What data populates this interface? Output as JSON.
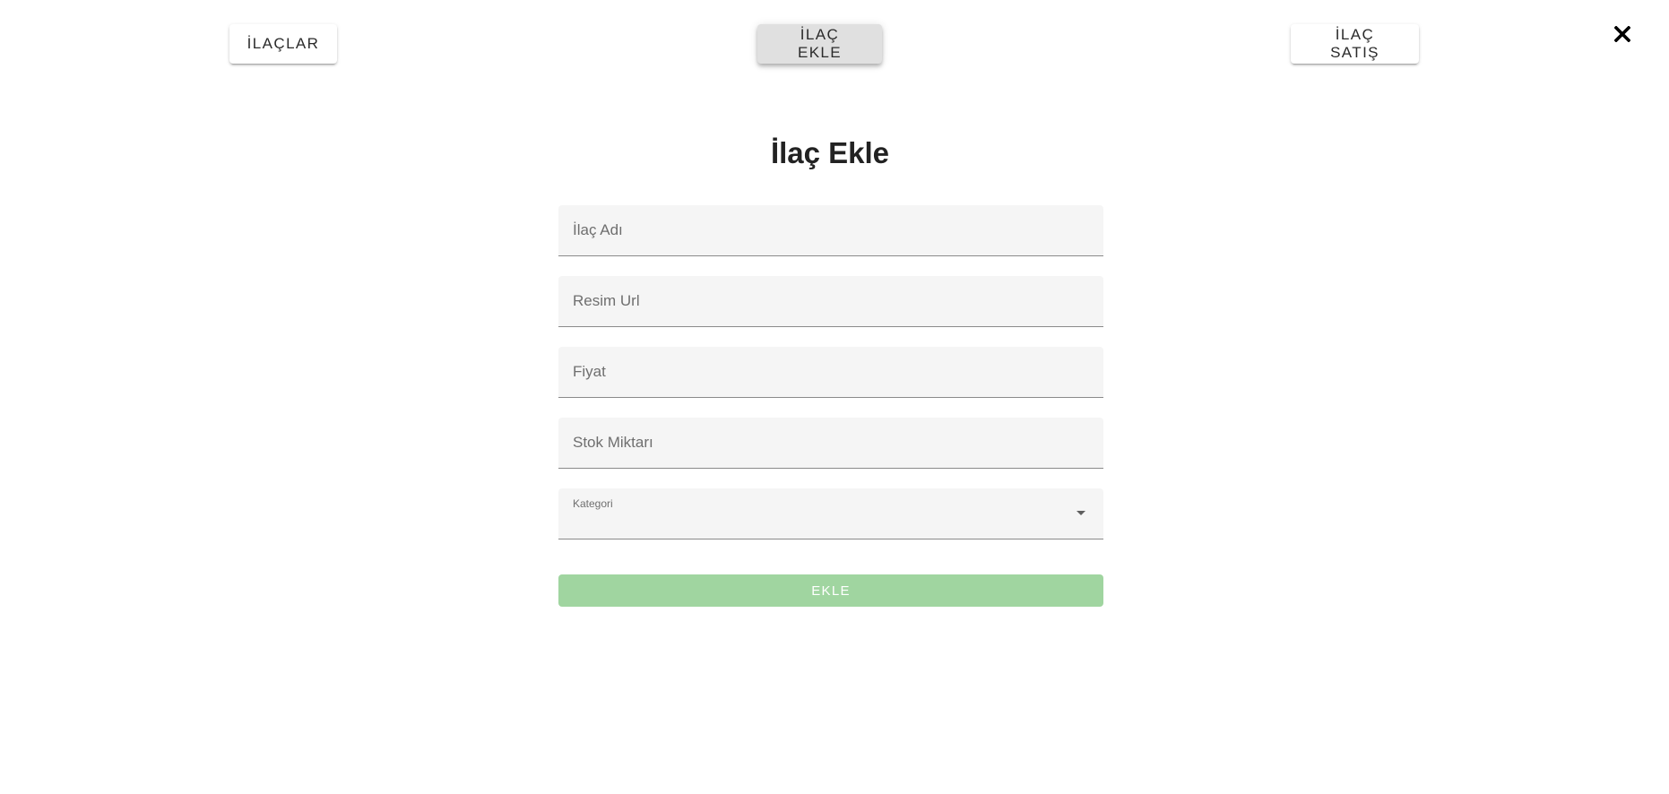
{
  "nav": {
    "ilaclar_label": "İLAÇLAR",
    "ilac_ekle_label": "İLAÇ EKLE",
    "ilac_satis_label": "İLAÇ SATIŞ",
    "active_tab": "ilac_ekle"
  },
  "icons": {
    "close": "close-icon",
    "dropdown": "arrow-drop-down-icon"
  },
  "form": {
    "title": "İlaç Ekle",
    "fields": {
      "ilac_adi": {
        "placeholder": "İlaç Adı",
        "value": ""
      },
      "resim_url": {
        "placeholder": "Resim Url",
        "value": ""
      },
      "fiyat": {
        "placeholder": "Fiyat",
        "value": ""
      },
      "stok_miktari": {
        "placeholder": "Stok Miktarı",
        "value": ""
      },
      "kategori": {
        "label": "Kategori",
        "value": ""
      }
    },
    "submit_label": "EKLE",
    "submit_disabled": true
  },
  "colors": {
    "submit_bg": "#a0d5a0",
    "field_bg": "#f5f5f5",
    "active_tab_bg": "#e0e0e0"
  }
}
